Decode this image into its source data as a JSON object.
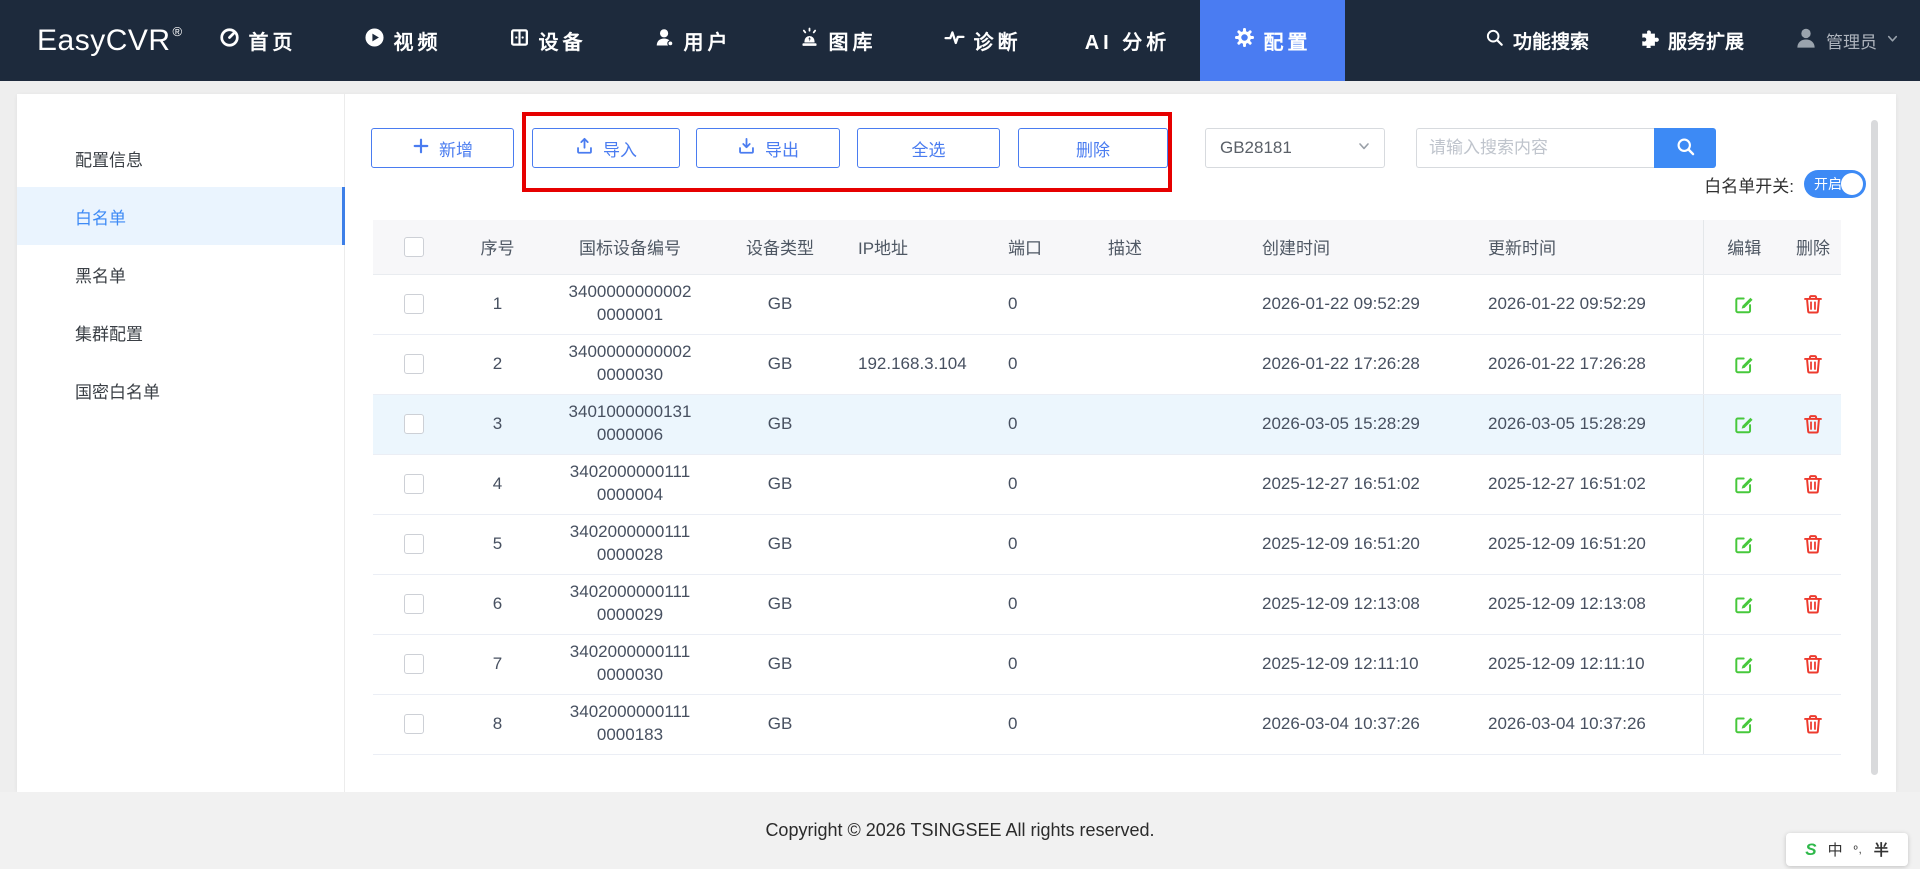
{
  "colors": {
    "navbar_bg": "#1d2a3c",
    "active_tab_blue": "#4a7cf2",
    "button_blue": "#4a7cf0",
    "primary_blue": "#3d8af5",
    "annotation_red": "#e60000",
    "edit_green": "#47c83c",
    "delete_red": "#ed3b2e",
    "sidebar_active_bg": "#eaf4fe",
    "row_highlight": "#ecf6fd"
  },
  "navbar": {
    "logo": "EasyCVR",
    "logo_sup": "®",
    "items": [
      {
        "label": "首页",
        "icon": "dashboard-icon",
        "active": false
      },
      {
        "label": "视频",
        "icon": "play-icon",
        "active": false
      },
      {
        "label": "设备",
        "icon": "device-icon",
        "active": false
      },
      {
        "label": "用户",
        "icon": "user-icon",
        "active": false
      },
      {
        "label": "图库",
        "icon": "alarm-beacon-icon",
        "active": false
      },
      {
        "label": "诊断",
        "icon": "pulse-icon",
        "active": false
      },
      {
        "label": "AI 分析",
        "icon": null,
        "active": false
      },
      {
        "label": "配置",
        "icon": "gear-icon",
        "active": true
      }
    ],
    "right": {
      "function_search": "功能搜索",
      "service_extension": "服务扩展",
      "user": "管理员"
    }
  },
  "sidebar": {
    "items": [
      {
        "label": "配置信息",
        "active": false
      },
      {
        "label": "白名单",
        "active": true
      },
      {
        "label": "黑名单",
        "active": false
      },
      {
        "label": "集群配置",
        "active": false
      },
      {
        "label": "国密白名单",
        "active": false
      }
    ]
  },
  "toolbar": {
    "add": "新增",
    "import": "导入",
    "export": "导出",
    "select_all": "全选",
    "delete": "删除",
    "protocol_selected": "GB28181",
    "search_placeholder": "请输入搜索内容",
    "switch_label": "白名单开关:",
    "switch_state": "开启"
  },
  "table": {
    "headers": {
      "index": "序号",
      "device_id": "国标设备编号",
      "device_type": "设备类型",
      "ip": "IP地址",
      "port": "端口",
      "description": "描述",
      "created": "创建时间",
      "updated": "更新时间",
      "edit": "编辑",
      "delete": "删除"
    },
    "rows": [
      {
        "index": "1",
        "id": [
          "3400000000002",
          "0000001"
        ],
        "type": "GB",
        "ip": "",
        "port": "0",
        "desc": "",
        "created": "2026-01-22 09:52:29",
        "updated": "2026-01-22 09:52:29",
        "highlight": false
      },
      {
        "index": "2",
        "id": [
          "3400000000002",
          "0000030"
        ],
        "type": "GB",
        "ip": "192.168.3.104",
        "port": "0",
        "desc": "",
        "created": "2026-01-22 17:26:28",
        "updated": "2026-01-22 17:26:28",
        "highlight": false
      },
      {
        "index": "3",
        "id": [
          "3401000000131",
          "0000006"
        ],
        "type": "GB",
        "ip": "",
        "port": "0",
        "desc": "",
        "created": "2026-03-05 15:28:29",
        "updated": "2026-03-05 15:28:29",
        "highlight": true
      },
      {
        "index": "4",
        "id": [
          "3402000000111",
          "0000004"
        ],
        "type": "GB",
        "ip": "",
        "port": "0",
        "desc": "",
        "created": "2025-12-27 16:51:02",
        "updated": "2025-12-27 16:51:02",
        "highlight": false
      },
      {
        "index": "5",
        "id": [
          "3402000000111",
          "0000028"
        ],
        "type": "GB",
        "ip": "",
        "port": "0",
        "desc": "",
        "created": "2025-12-09 16:51:20",
        "updated": "2025-12-09 16:51:20",
        "highlight": false
      },
      {
        "index": "6",
        "id": [
          "3402000000111",
          "0000029"
        ],
        "type": "GB",
        "ip": "",
        "port": "0",
        "desc": "",
        "created": "2025-12-09 12:13:08",
        "updated": "2025-12-09 12:13:08",
        "highlight": false
      },
      {
        "index": "7",
        "id": [
          "3402000000111",
          "0000030"
        ],
        "type": "GB",
        "ip": "",
        "port": "0",
        "desc": "",
        "created": "2025-12-09 12:11:10",
        "updated": "2025-12-09 12:11:10",
        "highlight": false
      },
      {
        "index": "8",
        "id": [
          "3402000000111",
          "0000183"
        ],
        "type": "GB",
        "ip": "",
        "port": "0",
        "desc": "",
        "created": "2026-03-04 10:37:26",
        "updated": "2026-03-04 10:37:26",
        "highlight": false
      }
    ]
  },
  "footer": {
    "copyright": "Copyright © 2026 TSINGSEE All rights reserved."
  },
  "ime": {
    "engine": "S",
    "mode": "中",
    "punctuation": "º,",
    "width": "半"
  }
}
